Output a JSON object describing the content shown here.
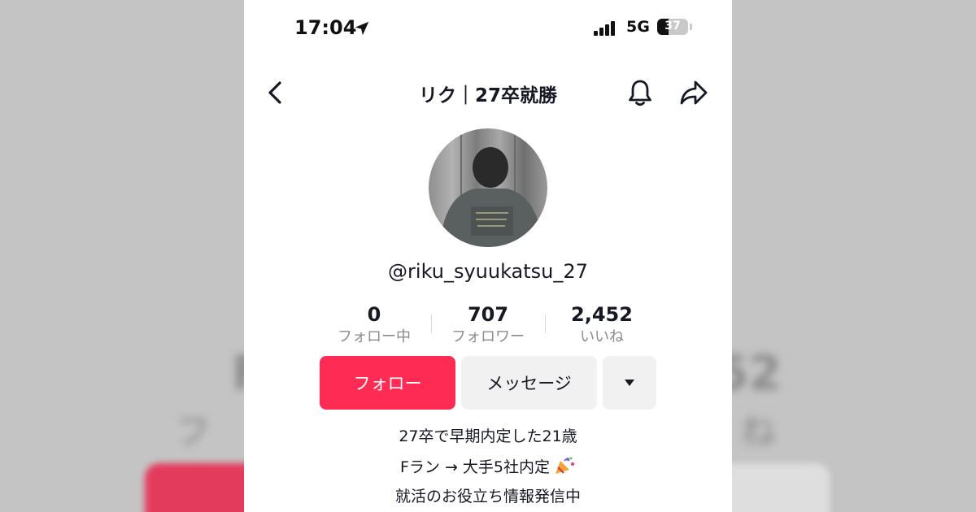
{
  "status_bar": {
    "time": "17:04",
    "network": "5G",
    "battery": "37",
    "battery_fraction": 0.37
  },
  "nav": {
    "title": "リク｜27卒就勝"
  },
  "profile": {
    "handle": "@riku_syuukatsu_27",
    "stats": [
      {
        "value": "0",
        "label": "フォロー中"
      },
      {
        "value": "707",
        "label": "フォロワー"
      },
      {
        "value": "2,452",
        "label": "いいね"
      }
    ],
    "follow_label": "フォロー",
    "message_label": "メッセージ",
    "bio": [
      "27卒で早期内定した21歳",
      "Fラン → 大手5社内定",
      "就活のお役立ち情報発信中"
    ]
  },
  "background_blur": {
    "left_a": "Fa",
    "left_b": "フォ",
    "right_a": "52",
    "right_b": "ね"
  },
  "colors": {
    "accent": "#fe2c55",
    "secondary_button": "#f1f1f2",
    "muted_text": "#8a8b91"
  },
  "icons": [
    "location-arrow-icon",
    "signal-icon",
    "battery-icon",
    "back-arrow-icon",
    "bell-icon",
    "share-icon",
    "caret-down-icon",
    "party-popper-icon"
  ]
}
